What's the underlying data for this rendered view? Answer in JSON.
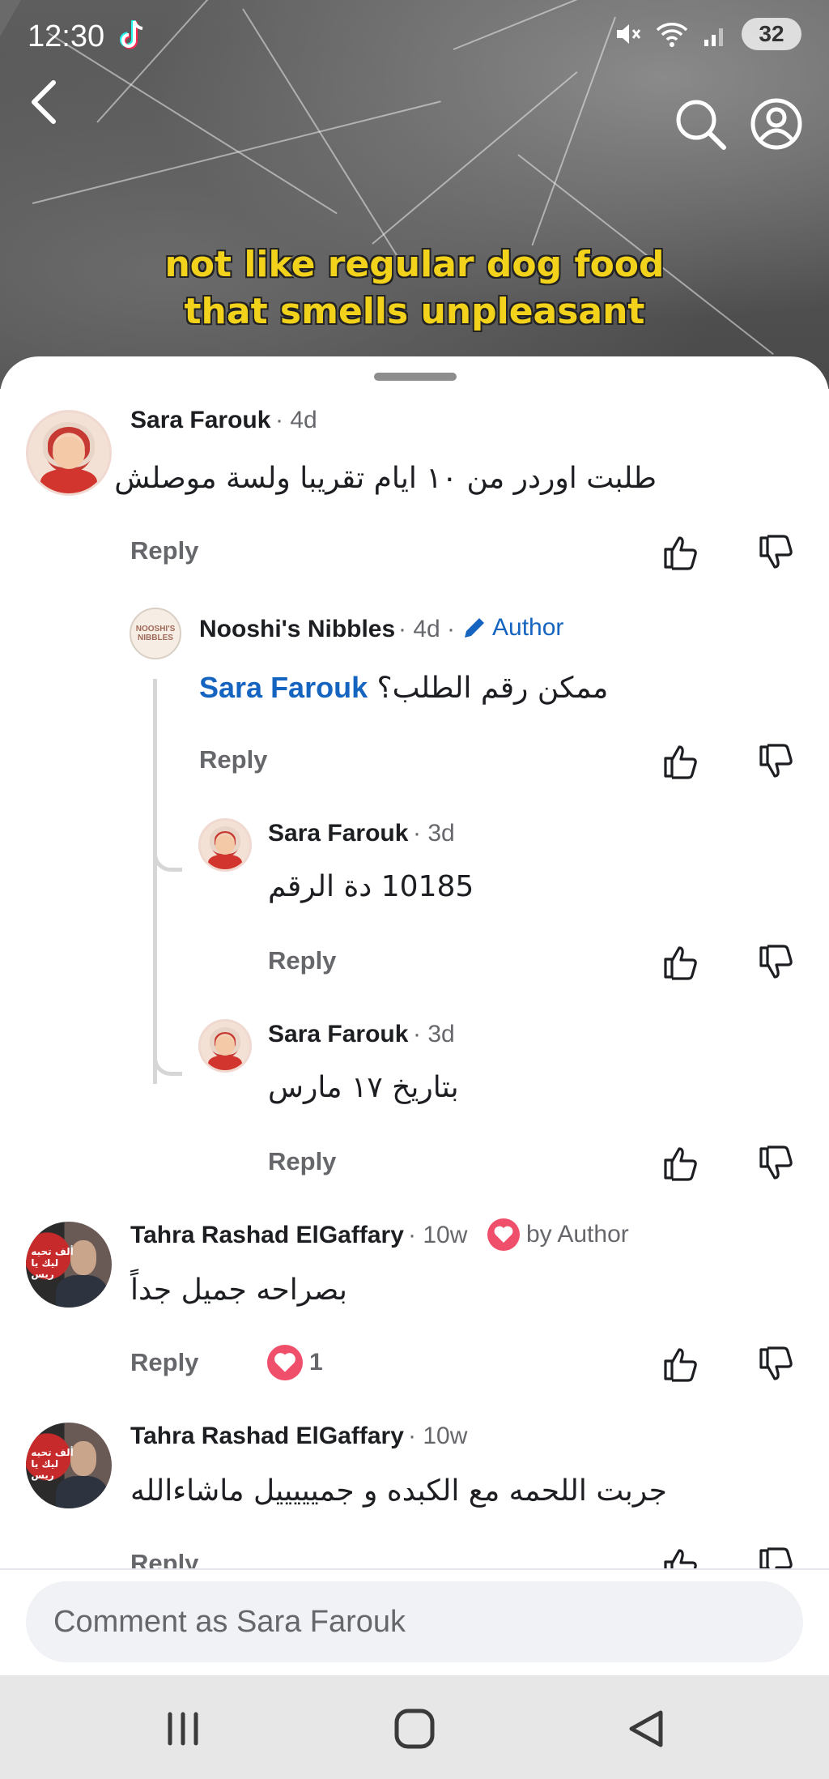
{
  "status_bar": {
    "time": "12:30",
    "battery": "32"
  },
  "video": {
    "caption_line1": "not like regular dog food",
    "caption_line2": "that smells unpleasant"
  },
  "comments": [
    {
      "name": "Sara Farouk",
      "meta": "· 4d",
      "text": "طلبت اوردر من ١٠ ايام تقريبا ولسة موصلش",
      "reply": "Reply"
    },
    {
      "name": "Nooshi's Nibbles",
      "meta": "· 4d ·",
      "author_label": "Author",
      "mention": "Sara Farouk",
      "text": "ممكن رقم الطلب؟",
      "reply": "Reply",
      "avatar_text": "NOOSHI'S NIBBLES"
    },
    {
      "name": "Sara Farouk",
      "meta": "· 3d",
      "text": "10185 دة الرقم",
      "reply": "Reply"
    },
    {
      "name": "Sara Farouk",
      "meta": "· 3d",
      "text": "بتاريخ ١٧ مارس",
      "reply": "Reply"
    },
    {
      "name": "Tahra Rashad ElGaffary",
      "meta": "· 10w",
      "liked_by": "by Author",
      "text": "بصراحه جميل جداً",
      "reply": "Reply",
      "reaction_count": "1",
      "avatar_text": "ألف تحيه ليك يا ريس"
    },
    {
      "name": "Tahra Rashad ElGaffary",
      "meta": "· 10w",
      "text": "جربت اللحمه مع الكبده و جميييييل ماشاءالله",
      "reply": "Reply",
      "avatar_text": "ألف تحيه ليك يا ريس"
    }
  ],
  "input": {
    "placeholder": "Comment as Sara Farouk"
  },
  "icons": [
    "tiktok-icon",
    "mute-icon",
    "wifi-icon",
    "signal-icon",
    "back-icon",
    "search-icon",
    "account-icon",
    "thumbs-up-icon",
    "thumbs-down-icon",
    "pencil-icon",
    "heart-icon",
    "recent-apps-icon",
    "home-icon",
    "back-nav-icon"
  ],
  "colors": {
    "accent": "#1565c0",
    "heart": "#ef4f6a",
    "caption": "#f2d21a"
  }
}
